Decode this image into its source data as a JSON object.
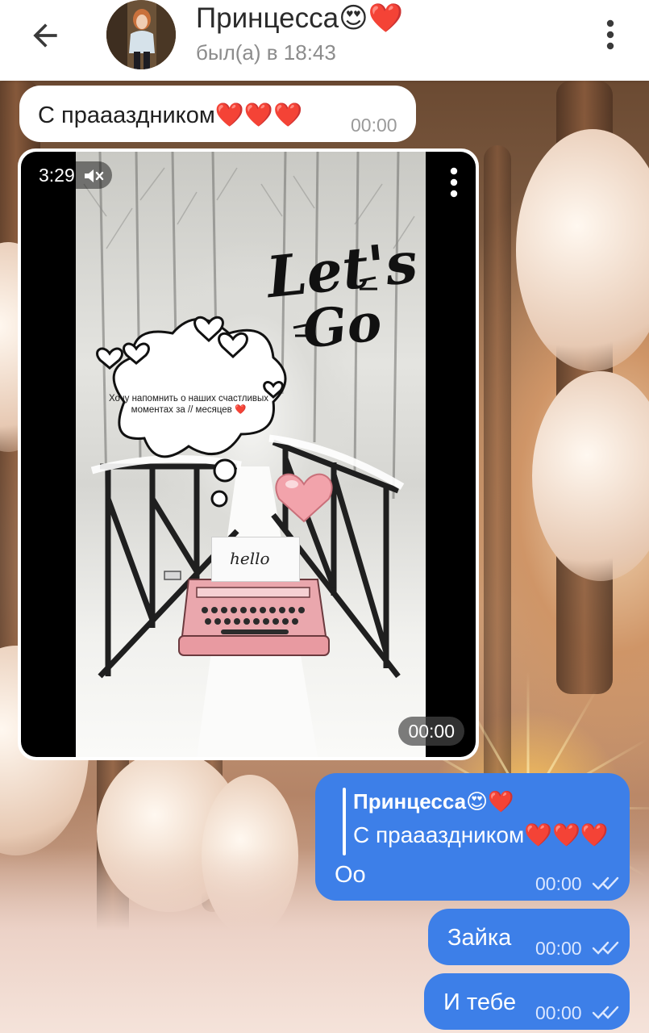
{
  "header": {
    "contact_name": "Принцесса😍❤️",
    "last_seen": "был(а) в 18:43",
    "icons": {
      "back": "arrow-left-icon",
      "menu": "more-vertical-icon"
    }
  },
  "messages": [
    {
      "id": "m1",
      "direction": "incoming",
      "text": "С праааздником❤️❤️❤️",
      "time": "00:00"
    },
    {
      "id": "m2",
      "direction": "incoming",
      "type": "video",
      "duration": "3:29",
      "muted": true,
      "time": "00:00",
      "overlay_text": "Хочу напомнить о наших счастливых моментах за // месяцев ❤️",
      "lettering": "Let's Go",
      "note_text": "hello"
    },
    {
      "id": "m3",
      "direction": "outgoing",
      "reply_to": {
        "name": "Принцесса😍❤️",
        "text": "С праааздником❤️❤️❤️"
      },
      "text": "Оо",
      "time": "00:00",
      "status": "read"
    },
    {
      "id": "m4",
      "direction": "outgoing",
      "text": "Зайка",
      "time": "00:00",
      "status": "read"
    },
    {
      "id": "m5",
      "direction": "outgoing",
      "text": "И тебе",
      "time": "00:00",
      "status": "read"
    }
  ],
  "colors": {
    "outgoing_bubble": "#3d7fe8",
    "incoming_bubble": "#ffffff",
    "header_bg": "#ffffff"
  }
}
